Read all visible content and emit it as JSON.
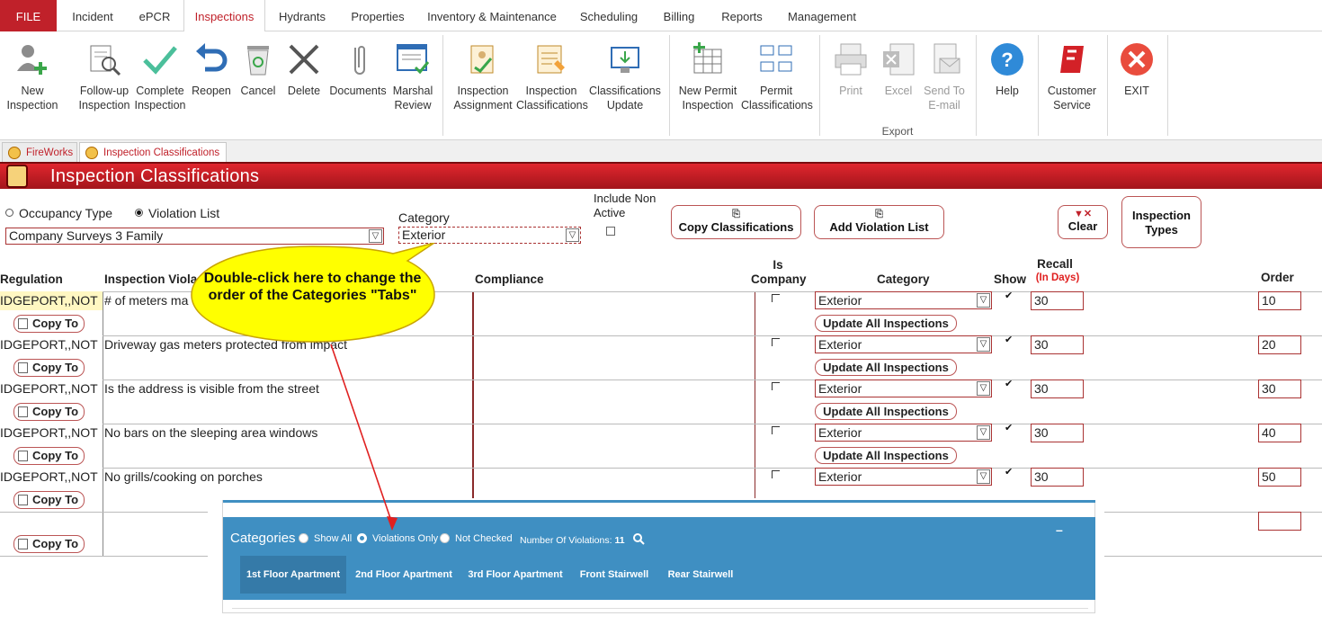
{
  "menu": {
    "file": "FILE",
    "items": [
      "Incident",
      "ePCR",
      "Inspections",
      "Hydrants",
      "Properties",
      "Inventory & Maintenance",
      "Scheduling",
      "Billing",
      "Reports",
      "Management"
    ],
    "active": "Inspections"
  },
  "ribbon": {
    "new_inspection": "New Inspection",
    "followup": "Follow-up Inspection",
    "complete": "Complete Inspection",
    "reopen": "Reopen",
    "cancel": "Cancel",
    "delete": "Delete",
    "documents": "Documents",
    "marshal_review": "Marshal Review",
    "inspection_assignment": "Inspection Assignment",
    "inspection_classifications": "Inspection Classifications",
    "classifications_update": "Classifications Update",
    "new_permit": "New Permit Inspection",
    "permit_classifications": "Permit Classifications",
    "print": "Print",
    "excel": "Excel",
    "send_email": "Send To E-mail",
    "export_group": "Export",
    "help": "Help",
    "customer_service": "Customer Service",
    "exit": "EXIT"
  },
  "doc_tabs": [
    "FireWorks",
    "Inspection Classifications"
  ],
  "title": "Inspection Classifications",
  "filters": {
    "occupancy_type": "Occupancy Type",
    "violation_list": "Violation List",
    "selected_mode": "Violation List",
    "list_value": "Company Surveys 3 Family",
    "category_label": "Category",
    "category_value": "Exterior",
    "include_non_active": "Include Non Active",
    "copy_classifications": "Copy Classifications",
    "add_violation_list": "Add Violation List",
    "clear": "Clear",
    "inspection_types": "Inspection Types"
  },
  "columns": {
    "regulation": "Regulation",
    "violation": "Inspection Viola",
    "compliance": "Compliance",
    "is_company": "Is Company",
    "category": "Category",
    "show": "Show",
    "recall": "Recall",
    "recall_unit": "(In Days)",
    "order": "Order"
  },
  "rows": [
    {
      "regulation": "IDGEPORT,,NOT",
      "violation": "# of meters ma",
      "category": "Exterior",
      "recall": "30",
      "order": "10"
    },
    {
      "regulation": "IDGEPORT,,NOT",
      "violation": "Driveway gas meters protected from impact",
      "category": "Exterior",
      "recall": "30",
      "order": "20"
    },
    {
      "regulation": "IDGEPORT,,NOT",
      "violation": "Is the address is visible from the street",
      "category": "Exterior",
      "recall": "30",
      "order": "30"
    },
    {
      "regulation": "IDGEPORT,,NOT",
      "violation": "No bars on the sleeping area windows",
      "category": "Exterior",
      "recall": "30",
      "order": "40"
    },
    {
      "regulation": "IDGEPORT,,NOT",
      "violation": "No grills/cooking on porches",
      "category": "Exterior",
      "recall": "30",
      "order": "50"
    }
  ],
  "copy_to": "Copy To",
  "update_all": "Update All  Inspections",
  "callout": "Double-click here to change the order of the Categories \"Tabs\"",
  "overlay": {
    "categories": "Categories",
    "show_all": "Show All",
    "violations_only": "Violations Only",
    "not_checked": "Not Checked",
    "num_violations_label": "Number Of Violations:",
    "num_violations": "11",
    "minimize": "–",
    "tabs": [
      "1st Floor Apartment",
      "2nd Floor Apartment",
      "3rd Floor Apartment",
      "Front Stairwell",
      "Rear Stairwell"
    ]
  },
  "colors": {
    "accent": "#c0212a",
    "panel": "#3f8fc2",
    "callout": "#ffff00"
  }
}
